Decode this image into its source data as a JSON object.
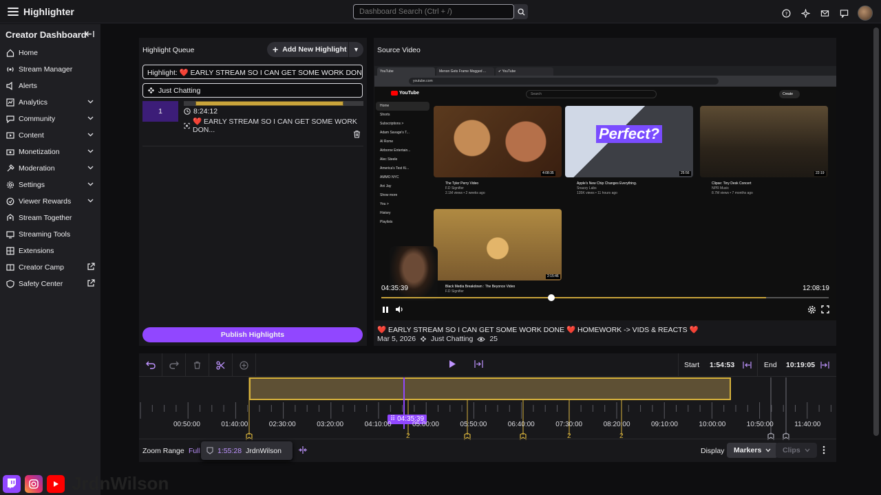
{
  "app": {
    "title": "Highlighter"
  },
  "search": {
    "placeholder": "Dashboard Search (Ctrl + /)"
  },
  "sidebar": {
    "title": "Creator Dashboard",
    "items": [
      {
        "label": "Home",
        "icon": "home-icon",
        "chevron": false,
        "ext": false
      },
      {
        "label": "Stream Manager",
        "icon": "stream-manager-icon",
        "chevron": false,
        "ext": false
      },
      {
        "label": "Alerts",
        "icon": "alerts-icon",
        "chevron": false,
        "ext": false
      },
      {
        "label": "Analytics",
        "icon": "analytics-icon",
        "chevron": true,
        "ext": false
      },
      {
        "label": "Community",
        "icon": "community-icon",
        "chevron": true,
        "ext": false
      },
      {
        "label": "Content",
        "icon": "content-icon",
        "chevron": true,
        "ext": false
      },
      {
        "label": "Monetization",
        "icon": "monetization-icon",
        "chevron": true,
        "ext": false
      },
      {
        "label": "Moderation",
        "icon": "moderation-icon",
        "chevron": true,
        "ext": false
      },
      {
        "label": "Settings",
        "icon": "settings-icon",
        "chevron": true,
        "ext": false
      },
      {
        "label": "Viewer Rewards",
        "icon": "viewer-rewards-icon",
        "chevron": true,
        "ext": false
      },
      {
        "label": "Stream Together",
        "icon": "stream-together-icon",
        "chevron": false,
        "ext": false
      },
      {
        "label": "Streaming Tools",
        "icon": "streaming-tools-icon",
        "chevron": false,
        "ext": false
      },
      {
        "label": "Extensions",
        "icon": "extensions-icon",
        "chevron": false,
        "ext": false
      },
      {
        "label": "Creator Camp",
        "icon": "creator-camp-icon",
        "chevron": false,
        "ext": true
      },
      {
        "label": "Safety Center",
        "icon": "safety-center-icon",
        "chevron": false,
        "ext": true
      }
    ]
  },
  "queue": {
    "title": "Highlight Queue",
    "add_label": "Add New Highlight",
    "title_field": "Highlight: ❤️ EARLY STREAM SO I CAN GET SOME WORK DONE ❤️ HOMEWORK",
    "category_field": "Just Chatting",
    "item": {
      "number": "1",
      "time": "8:24:12",
      "name": "❤️ EARLY STREAM SO I CAN GET SOME WORK DON...",
      "segment_start": 0.066,
      "segment_end": 0.89
    },
    "publish_label": "Publish Highlights"
  },
  "source": {
    "title": "Source Video",
    "current_time": "04:35:39",
    "duration": "12:08:19",
    "progress": 0.38,
    "buffered": 0.86,
    "caption": "❤️ EARLY STREAM SO I CAN GET SOME WORK DONE ❤️ HOMEWORK -> VIDS & REACTS ❤️",
    "date": "Mar 5, 2026",
    "category": "Just Chatting",
    "views": "25",
    "youtube": {
      "tabs": [
        "YouTube",
        "Menon Gets Frame Mogged ...",
        "✔ YouTube"
      ],
      "url": "youtube.com",
      "search_placeholder": "Search",
      "create": "Create",
      "side": [
        "Home",
        "Shorts",
        "Subscriptions  >",
        "Adam Savage's T...",
        "Al Rome",
        "Airborne Entertain...",
        "Alec Steele",
        "America's Test Ki...",
        "AMMO NYC",
        "Ani Jay",
        "Show more",
        "You  >",
        "History",
        "Playlists"
      ],
      "videos": [
        {
          "title": "The Tyler Perry Video",
          "channel": "F.D Signifier",
          "stats": "2.1M views • 2 weeks ago",
          "dur": "4:08:35"
        },
        {
          "title": "Apple's New Chip Changes Everything.",
          "channel": "Snazzy Labs",
          "stats": "135K views • 11 hours ago",
          "dur": "25:56",
          "overlay": "Perfect?"
        },
        {
          "title": "Clipse: Tiny Desk Concert",
          "channel": "NPR Music",
          "stats": "8.7M views • 7 months ago",
          "dur": "22:19"
        },
        {
          "title": "Black Media Breakdown : The Beyonce Video",
          "channel": "F.D Signifier",
          "stats": "",
          "dur": "2:15:46"
        }
      ]
    }
  },
  "timeline": {
    "start_label": "Start",
    "start_value": "1:54:53",
    "end_label": "End",
    "end_value": "10:19:05",
    "playhead_label": "04:35:39",
    "ticks": [
      "00:50:00",
      "01:40:00",
      "02:30:00",
      "03:20:00",
      "04:10:00",
      "05:00:00",
      "05:50:00",
      "06:40:00",
      "07:30:00",
      "08:20:00",
      "09:10:00",
      "10:00:00",
      "10:50:00",
      "11:40:00"
    ],
    "marker_counts": [
      "2",
      "2",
      "2"
    ],
    "zoom_label": "Zoom Range",
    "zoom_value": "Full",
    "popup_time": "1:55:28",
    "popup_user": "JrdnWilson",
    "display_label": "Display",
    "markers_label": "Markers",
    "clips_label": "Clips"
  },
  "brand": {
    "name": "JrdnWilson"
  },
  "colors": {
    "accent": "#9147ff",
    "gold": "#d7b23c",
    "panel": "#18181b"
  }
}
